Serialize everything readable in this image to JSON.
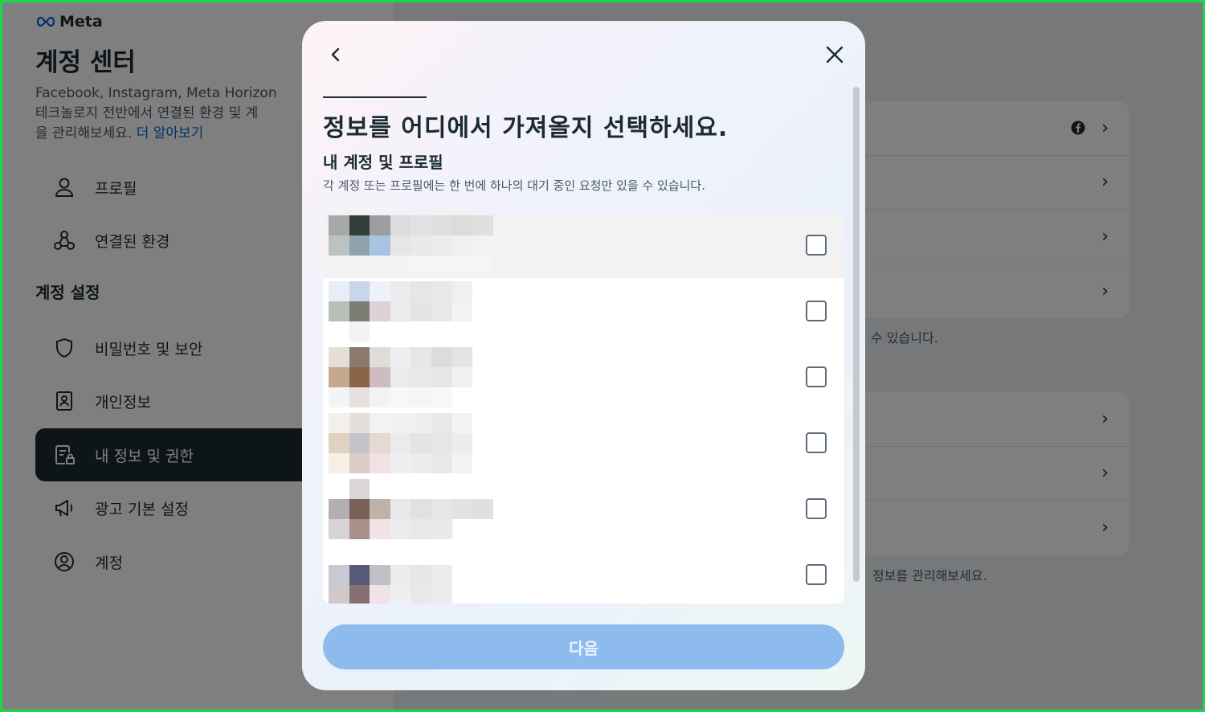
{
  "background": {
    "brand": "Meta",
    "title": "계정 센터",
    "description": "Facebook, Instagram, Meta Horizon 등 Meta 테크놀로지 전반에서 연결된 환경 및 계정 설정을 관리해보세요.",
    "description_lines": [
      "Facebook, Instagram, Meta Horizon",
      "테크놀로지 전반에서 연결된 환경 및 계",
      "을 관리해보세요."
    ],
    "learn_more": "더 알아보기",
    "nav": [
      {
        "label": "프로필",
        "icon": "person-icon"
      },
      {
        "label": "연결된 환경",
        "icon": "connected-icon"
      }
    ],
    "settings_heading": "계정 설정",
    "settings_nav": [
      {
        "label": "비밀번호 및 보안",
        "icon": "shield-icon"
      },
      {
        "label": "개인정보",
        "icon": "id-card-icon"
      },
      {
        "label": "내 정보 및 권한",
        "icon": "info-lock-icon",
        "active": true
      },
      {
        "label": "광고 기본 설정",
        "icon": "megaphone-icon"
      },
      {
        "label": "계정",
        "icon": "account-circle-icon"
      }
    ],
    "note_1": "수 있습니다.",
    "note_2": "정보를 관리해보세요."
  },
  "modal": {
    "title": "정보를 어디에서 가져올지 선택하세요.",
    "subtitle": "내 계정 및 프로필",
    "note": "각 계정 또는 프로필에는 한 번에 하나의 대기 중인 요청만 있을 수 있습니다.",
    "next_label": "다음",
    "accounts_count": 6
  },
  "colors": {
    "accent": "#0064e0",
    "primary_disabled": "#8dbbee",
    "nav_active": "#1c2b33",
    "frame": "#1ed64a"
  }
}
